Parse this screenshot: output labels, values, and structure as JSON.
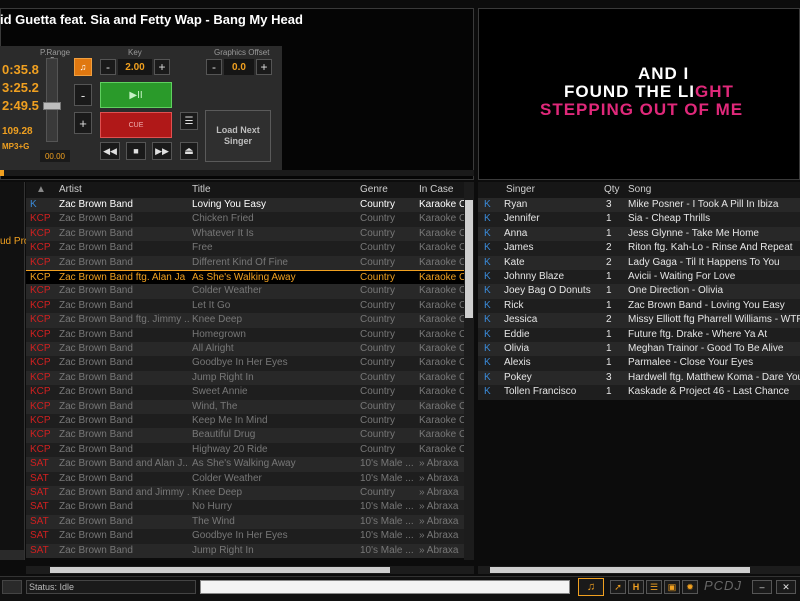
{
  "player": {
    "song_title": "id Guetta feat. Sia and Fetty Wap - Bang My Head",
    "time_elapsed": "0:35.8",
    "time_total": "3:25.2",
    "time_remaining": "2:49.5",
    "bpm": "109.28",
    "format": "MP3+G",
    "pitch_range_label": "P.Range",
    "pitch_range_value": "8",
    "pitch_readout": "00.00",
    "key_label": "Key",
    "key_value": "2.00",
    "graphics_offset_label": "Graphics Offset",
    "graphics_offset_value": "0.0",
    "minus": "-",
    "plus": "+",
    "play_label": "▶II",
    "cue_label": "CUE",
    "load_next_label": "Load Next Singer",
    "progress_fraction": 0.008
  },
  "lyrics": {
    "line1": "AND I",
    "line2_part1": "FOUND THE LI",
    "line2_part2": "GHT",
    "line3": "STEPPING OUT OF ME"
  },
  "side_label": "ud Pro",
  "catalog": {
    "columns": [
      "Artist",
      "Title",
      "Genre",
      "In Case"
    ],
    "rows": [
      {
        "tag": "K",
        "artist": "Zac Brown Band",
        "title": "Loving You Easy",
        "genre": "Country",
        "case": "Karaoke Cl"
      },
      {
        "tag": "KCP",
        "artist": "Zac Brown Band",
        "title": "Chicken Fried",
        "genre": "Country",
        "case": "Karaoke Cl"
      },
      {
        "tag": "KCP",
        "artist": "Zac Brown Band",
        "title": "Whatever It Is",
        "genre": "Country",
        "case": "Karaoke Cl"
      },
      {
        "tag": "KCP",
        "artist": "Zac Brown Band",
        "title": "Free",
        "genre": "Country",
        "case": "Karaoke Cl"
      },
      {
        "tag": "KCP",
        "artist": "Zac Brown Band",
        "title": "Different Kind Of Fine",
        "genre": "Country",
        "case": "Karaoke Cl"
      },
      {
        "tag": "KCP",
        "artist": "Zac Brown Band ftg. Alan Ja",
        "title": "As She's Walking Away",
        "genre": "Country",
        "case": "Karaoke Cl"
      },
      {
        "tag": "KCP",
        "artist": "Zac Brown Band",
        "title": "Colder Weather",
        "genre": "Country",
        "case": "Karaoke Cl"
      },
      {
        "tag": "KCP",
        "artist": "Zac Brown Band",
        "title": "Let It Go",
        "genre": "Country",
        "case": "Karaoke Cl"
      },
      {
        "tag": "KCP",
        "artist": "Zac Brown Band ftg. Jimmy ...",
        "title": "Knee Deep",
        "genre": "Country",
        "case": "Karaoke Cl"
      },
      {
        "tag": "KCP",
        "artist": "Zac Brown Band",
        "title": "Homegrown",
        "genre": "Country",
        "case": "Karaoke Cl"
      },
      {
        "tag": "KCP",
        "artist": "Zac Brown Band",
        "title": "All Alright",
        "genre": "Country",
        "case": "Karaoke Cl"
      },
      {
        "tag": "KCP",
        "artist": "Zac Brown Band",
        "title": "Goodbye In Her Eyes",
        "genre": "Country",
        "case": "Karaoke Cl"
      },
      {
        "tag": "KCP",
        "artist": "Zac Brown Band",
        "title": "Jump Right In",
        "genre": "Country",
        "case": "Karaoke Cl"
      },
      {
        "tag": "KCP",
        "artist": "Zac Brown Band",
        "title": "Sweet Annie",
        "genre": "Country",
        "case": "Karaoke Cl"
      },
      {
        "tag": "KCP",
        "artist": "Zac Brown Band",
        "title": "Wind, The",
        "genre": "Country",
        "case": "Karaoke Cl"
      },
      {
        "tag": "KCP",
        "artist": "Zac Brown Band",
        "title": "Keep Me In Mind",
        "genre": "Country",
        "case": "Karaoke Cl"
      },
      {
        "tag": "KCP",
        "artist": "Zac Brown Band",
        "title": "Beautiful Drug",
        "genre": "Country",
        "case": "Karaoke Cl"
      },
      {
        "tag": "KCP",
        "artist": "Zac Brown Band",
        "title": "Highway 20 Ride",
        "genre": "Country",
        "case": "Karaoke Cl"
      },
      {
        "tag": "SAT",
        "artist": "Zac Brown Band and Alan J...",
        "title": "As She's Walking Away",
        "genre": "10's Male ...",
        "case": "» Abraxa"
      },
      {
        "tag": "SAT",
        "artist": "Zac Brown Band",
        "title": "Colder Weather",
        "genre": "10's Male ...",
        "case": "» Abraxa"
      },
      {
        "tag": "SAT",
        "artist": "Zac Brown Band and Jimmy ...",
        "title": "Knee Deep",
        "genre": "Country",
        "case": "» Abraxa"
      },
      {
        "tag": "SAT",
        "artist": "Zac Brown Band",
        "title": "No Hurry",
        "genre": "10's Male ...",
        "case": "» Abraxa"
      },
      {
        "tag": "SAT",
        "artist": "Zac Brown Band",
        "title": "The Wind",
        "genre": "10's Male ...",
        "case": "» Abraxa"
      },
      {
        "tag": "SAT",
        "artist": "Zac Brown Band",
        "title": "Goodbye In Her Eyes",
        "genre": "10's Male ...",
        "case": "» Abraxa"
      },
      {
        "tag": "SAT",
        "artist": "Zac Brown Band",
        "title": "Jump Right In",
        "genre": "10's Male ...",
        "case": "» Abraxa"
      }
    ],
    "selected_row": 5
  },
  "queue": {
    "columns": [
      "Singer",
      "Qty",
      "Song"
    ],
    "rows": [
      {
        "tag": "K",
        "singer": "Ryan",
        "qty": "3",
        "song": "Mike Posner - I Took A Pill In Ibiza"
      },
      {
        "tag": "K",
        "singer": "Jennifer",
        "qty": "1",
        "song": "Sia - Cheap Thrills"
      },
      {
        "tag": "K",
        "singer": "Anna",
        "qty": "1",
        "song": "Jess Glynne - Take Me Home"
      },
      {
        "tag": "K",
        "singer": "James",
        "qty": "2",
        "song": "Riton ftg. Kah-Lo - Rinse And Repeat"
      },
      {
        "tag": "K",
        "singer": "Kate",
        "qty": "2",
        "song": "Lady Gaga - Til It Happens To You"
      },
      {
        "tag": "K",
        "singer": "Johnny Blaze",
        "qty": "1",
        "song": "Avicii - Waiting For Love"
      },
      {
        "tag": "K",
        "singer": "Joey Bag O Donuts",
        "qty": "1",
        "song": "One Direction - Olivia"
      },
      {
        "tag": "K",
        "singer": "Rick",
        "qty": "1",
        "song": "Zac Brown Band - Loving You Easy"
      },
      {
        "tag": "K",
        "singer": "Jessica",
        "qty": "2",
        "song": "Missy Elliott ftg Pharrell Williams - WTF (W"
      },
      {
        "tag": "K",
        "singer": "Eddie",
        "qty": "1",
        "song": "Future ftg. Drake - Where Ya At"
      },
      {
        "tag": "K",
        "singer": "Olivia",
        "qty": "1",
        "song": "Meghan Trainor - Good To Be Alive"
      },
      {
        "tag": "K",
        "singer": "Alexis",
        "qty": "1",
        "song": "Parmalee - Close Your Eyes"
      },
      {
        "tag": "K",
        "singer": "Pokey",
        "qty": "3",
        "song": "Hardwell ftg. Matthew Koma - Dare You"
      },
      {
        "tag": "K",
        "singer": "Tollen Francisco",
        "qty": "1",
        "song": "Kaskade & Project 46 - Last Chance"
      }
    ]
  },
  "status": {
    "text": "Status: Idle",
    "logo": "PCDJ"
  },
  "colors": {
    "orange": "#f0a020",
    "kcp_red": "#d02020",
    "k_blue": "#3a8ad8",
    "lyric_pink": "#e0287a"
  }
}
